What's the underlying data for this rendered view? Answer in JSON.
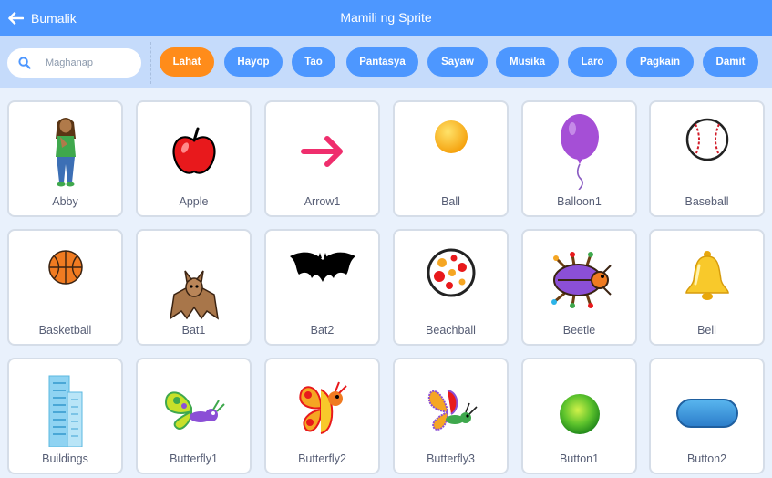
{
  "header": {
    "back_label": "Bumalik",
    "title": "Mamili ng Sprite"
  },
  "search": {
    "placeholder": "Maghanap"
  },
  "categories": [
    {
      "label": "Lahat",
      "active": true
    },
    {
      "label": "Hayop",
      "active": false
    },
    {
      "label": "Tao",
      "active": false
    },
    {
      "label": "Pantasya",
      "active": false
    },
    {
      "label": "Sayaw",
      "active": false
    },
    {
      "label": "Musika",
      "active": false
    },
    {
      "label": "Laro",
      "active": false
    },
    {
      "label": "Pagkain",
      "active": false
    },
    {
      "label": "Damit",
      "active": false
    }
  ],
  "sprites": [
    {
      "name": "Abby",
      "icon": "abby-icon"
    },
    {
      "name": "Apple",
      "icon": "apple-icon"
    },
    {
      "name": "Arrow1",
      "icon": "arrow-icon"
    },
    {
      "name": "Ball",
      "icon": "ball-icon"
    },
    {
      "name": "Balloon1",
      "icon": "balloon-icon"
    },
    {
      "name": "Baseball",
      "icon": "baseball-icon"
    },
    {
      "name": "Basketball",
      "icon": "basketball-icon"
    },
    {
      "name": "Bat1",
      "icon": "bat1-icon"
    },
    {
      "name": "Bat2",
      "icon": "bat2-icon"
    },
    {
      "name": "Beachball",
      "icon": "beachball-icon"
    },
    {
      "name": "Beetle",
      "icon": "beetle-icon"
    },
    {
      "name": "Bell",
      "icon": "bell-icon"
    },
    {
      "name": "Buildings",
      "icon": "buildings-icon"
    },
    {
      "name": "Butterfly1",
      "icon": "butterfly1-icon"
    },
    {
      "name": "Butterfly2",
      "icon": "butterfly2-icon"
    },
    {
      "name": "Butterfly3",
      "icon": "butterfly3-icon"
    },
    {
      "name": "Button1",
      "icon": "button1-icon"
    },
    {
      "name": "Button2",
      "icon": "button2-icon"
    }
  ],
  "colors": {
    "header": "#4d97ff",
    "filter_bar": "#c5dbfb",
    "tag": "#4d97ff",
    "tag_active": "#ff8c1a",
    "card_label": "#575e75"
  }
}
